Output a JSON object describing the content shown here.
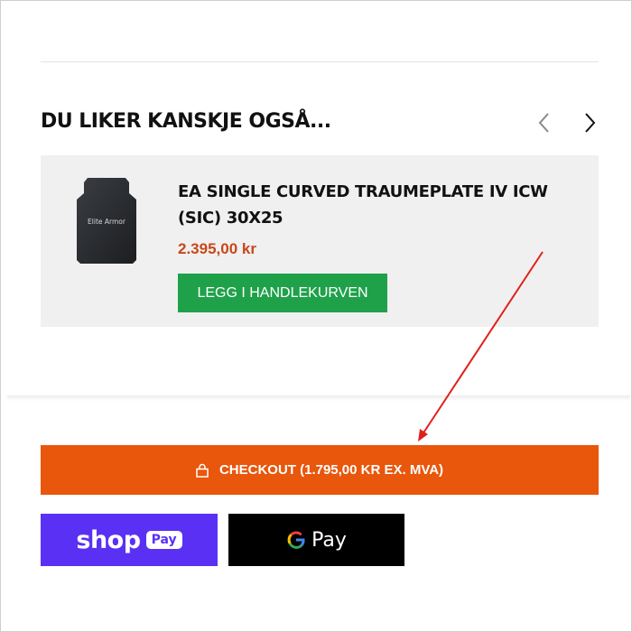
{
  "section": {
    "title": "DU LIKER KANSKJE OGSÅ..."
  },
  "carousel": {
    "prev_icon": "chevron-left-icon",
    "next_icon": "chevron-right-icon"
  },
  "product": {
    "image_brand_text": "Elite Armor",
    "name": "EA SINGLE CURVED TRAUMEPLATE IV ICW (SIC) 30X25",
    "price": "2.395,00 kr",
    "add_to_cart_label": "LEGG I HANDLEKURVEN"
  },
  "checkout": {
    "icon": "lock-icon",
    "label": "CHECKOUT (1.795,00 KR EX. MVA)"
  },
  "payments": {
    "shop_pay": {
      "shop_text": "shop",
      "pay_text": "Pay"
    },
    "google_pay": {
      "pay_text": "Pay"
    }
  },
  "colors": {
    "price": "#c8471a",
    "add_to_cart": "#1fa14a",
    "checkout": "#e8570c",
    "shop_pay": "#5a31f4",
    "google_pay": "#000000",
    "annotation_arrow": "#e0201b"
  }
}
